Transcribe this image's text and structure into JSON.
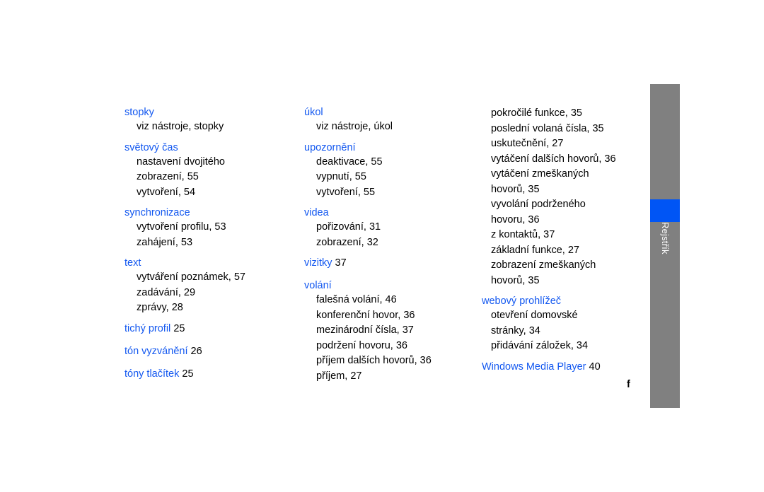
{
  "page": {
    "marker": "f",
    "background_color": "#ffffff",
    "heading_color": "#1358f0",
    "body_color": "#000000"
  },
  "tab_strip": {
    "label": "Rejstřík",
    "bar_color": "#808080",
    "highlight_color": "#0055f5",
    "label_color": "#ffffff"
  },
  "columns": [
    {
      "entries": [
        {
          "type": "group",
          "head": "stopky",
          "subs": [
            "viz nástroje, stopky"
          ]
        },
        {
          "type": "group",
          "head": "světový čas",
          "subs": [
            "nastavení dvojitého",
            "zobrazení, 55",
            "vytvoření, 54"
          ]
        },
        {
          "type": "group",
          "head": "synchronizace",
          "subs": [
            "vytvoření profilu, 53",
            "zahájení, 53"
          ]
        },
        {
          "type": "group",
          "head": "text",
          "subs": [
            "vytváření poznámek, 57",
            "zadávání, 29",
            "zprávy, 28"
          ]
        },
        {
          "type": "inline",
          "label": "tichý profil",
          "pageno": "25"
        },
        {
          "type": "inline",
          "label": "tón vyzvánění",
          "pageno": "26"
        },
        {
          "type": "inline",
          "label": "tóny tlačítek",
          "pageno": "25"
        }
      ]
    },
    {
      "entries": [
        {
          "type": "group",
          "head": "úkol",
          "subs": [
            "viz nástroje, úkol"
          ]
        },
        {
          "type": "group",
          "head": "upozornění",
          "subs": [
            "deaktivace, 55",
            "vypnutí, 55",
            "vytvoření, 55"
          ]
        },
        {
          "type": "group",
          "head": "videa",
          "subs": [
            "pořizování, 31",
            "zobrazení, 32"
          ]
        },
        {
          "type": "inline",
          "label": "vizitky",
          "pageno": "37"
        },
        {
          "type": "group",
          "head": "volání",
          "subs": [
            "falešná volání, 46",
            "konferenční hovor, 36",
            "mezinárodní čísla, 37",
            "podržení hovoru, 36",
            "příjem dalších hovorů, 36",
            "příjem, 27"
          ]
        }
      ]
    },
    {
      "entries": [
        {
          "type": "continuation",
          "subs": [
            "pokročilé funkce, 35",
            "poslední volaná čísla, 35",
            "uskutečnění, 27",
            "vytáčení dalších hovorů, 36",
            "vytáčení zmeškaných",
            "hovorů, 35",
            "vyvolání podrženého",
            "hovoru, 36",
            "z kontaktů, 37",
            "základní funkce, 27",
            "zobrazení zmeškaných",
            "hovorů, 35"
          ]
        },
        {
          "type": "group",
          "head": "webový prohlížeč",
          "subs": [
            "otevření domovské",
            "stránky, 34",
            "přidávání záložek, 34"
          ]
        },
        {
          "type": "inline",
          "label": "Windows Media Player",
          "pageno": "40"
        }
      ]
    }
  ]
}
